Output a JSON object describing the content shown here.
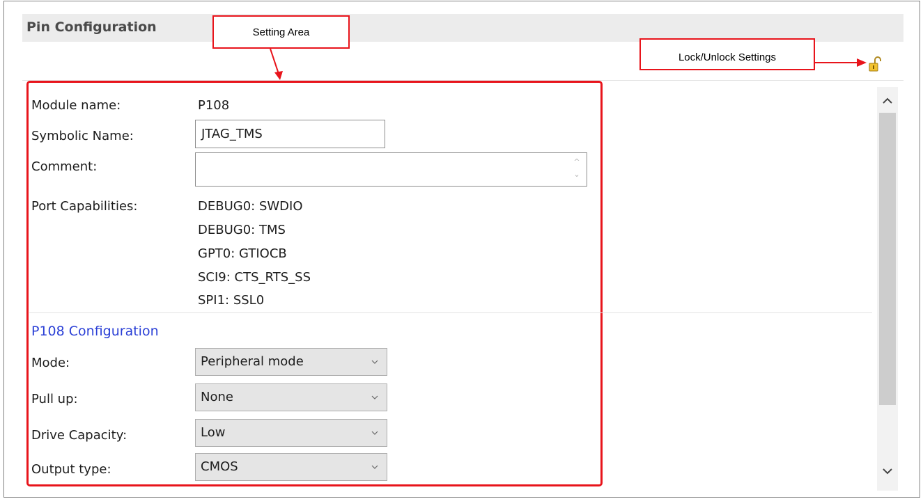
{
  "panel": {
    "title": "Pin Configuration"
  },
  "annotations": {
    "setting_area": "Setting Area",
    "lock_unlock": "Lock/Unlock Settings",
    "highlight_color": "#e8141b"
  },
  "fields": {
    "module_name": {
      "label": "Module name:",
      "value": "P108"
    },
    "symbolic_name": {
      "label": "Symbolic Name:",
      "value": "JTAG_TMS"
    },
    "comment": {
      "label": "Comment:",
      "value": ""
    },
    "port_capabilities": {
      "label": "Port Capabilities:",
      "items": [
        "DEBUG0: SWDIO",
        "DEBUG0: TMS",
        "GPT0: GTIOCB",
        "SCI9: CTS_RTS_SS",
        "SPI1: SSL0"
      ]
    }
  },
  "configuration": {
    "title": "P108 Configuration",
    "title_color": "#2a3fd6",
    "rows": [
      {
        "label": "Mode:",
        "value": "Peripheral mode"
      },
      {
        "label": "Pull up:",
        "value": "None"
      },
      {
        "label": "Drive Capacity:",
        "value": "Low"
      },
      {
        "label": "Output type:",
        "value": "CMOS"
      }
    ]
  },
  "icons": {
    "lock": "unlocked-padlock-icon",
    "scroll_up": "chevron-up-icon",
    "scroll_down": "chevron-down-icon"
  }
}
